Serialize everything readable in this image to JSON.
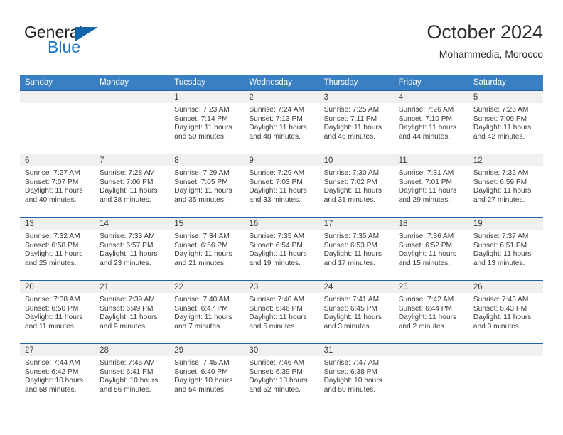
{
  "brand": {
    "name_part1": "General",
    "name_part2": "Blue",
    "accent_color": "#1264a8",
    "blue_text_color": "#1f76c2"
  },
  "header": {
    "title": "October 2024",
    "subtitle": "Mohammedia, Morocco"
  },
  "theme": {
    "header_row_bg": "#3a7fc1",
    "row_divider": "#1f63a8",
    "daynum_bg": "#f0f0f0",
    "text": "#3b3b3b"
  },
  "weekday_headers": [
    "Sunday",
    "Monday",
    "Tuesday",
    "Wednesday",
    "Thursday",
    "Friday",
    "Saturday"
  ],
  "weeks": [
    [
      {
        "day": "",
        "sunrise": "",
        "sunset": "",
        "daylight_line1": "",
        "daylight_line2": ""
      },
      {
        "day": "",
        "sunrise": "",
        "sunset": "",
        "daylight_line1": "",
        "daylight_line2": ""
      },
      {
        "day": "1",
        "sunrise": "Sunrise: 7:23 AM",
        "sunset": "Sunset: 7:14 PM",
        "daylight_line1": "Daylight: 11 hours",
        "daylight_line2": "and 50 minutes."
      },
      {
        "day": "2",
        "sunrise": "Sunrise: 7:24 AM",
        "sunset": "Sunset: 7:13 PM",
        "daylight_line1": "Daylight: 11 hours",
        "daylight_line2": "and 48 minutes."
      },
      {
        "day": "3",
        "sunrise": "Sunrise: 7:25 AM",
        "sunset": "Sunset: 7:11 PM",
        "daylight_line1": "Daylight: 11 hours",
        "daylight_line2": "and 46 minutes."
      },
      {
        "day": "4",
        "sunrise": "Sunrise: 7:26 AM",
        "sunset": "Sunset: 7:10 PM",
        "daylight_line1": "Daylight: 11 hours",
        "daylight_line2": "and 44 minutes."
      },
      {
        "day": "5",
        "sunrise": "Sunrise: 7:26 AM",
        "sunset": "Sunset: 7:09 PM",
        "daylight_line1": "Daylight: 11 hours",
        "daylight_line2": "and 42 minutes."
      }
    ],
    [
      {
        "day": "6",
        "sunrise": "Sunrise: 7:27 AM",
        "sunset": "Sunset: 7:07 PM",
        "daylight_line1": "Daylight: 11 hours",
        "daylight_line2": "and 40 minutes."
      },
      {
        "day": "7",
        "sunrise": "Sunrise: 7:28 AM",
        "sunset": "Sunset: 7:06 PM",
        "daylight_line1": "Daylight: 11 hours",
        "daylight_line2": "and 38 minutes."
      },
      {
        "day": "8",
        "sunrise": "Sunrise: 7:29 AM",
        "sunset": "Sunset: 7:05 PM",
        "daylight_line1": "Daylight: 11 hours",
        "daylight_line2": "and 35 minutes."
      },
      {
        "day": "9",
        "sunrise": "Sunrise: 7:29 AM",
        "sunset": "Sunset: 7:03 PM",
        "daylight_line1": "Daylight: 11 hours",
        "daylight_line2": "and 33 minutes."
      },
      {
        "day": "10",
        "sunrise": "Sunrise: 7:30 AM",
        "sunset": "Sunset: 7:02 PM",
        "daylight_line1": "Daylight: 11 hours",
        "daylight_line2": "and 31 minutes."
      },
      {
        "day": "11",
        "sunrise": "Sunrise: 7:31 AM",
        "sunset": "Sunset: 7:01 PM",
        "daylight_line1": "Daylight: 11 hours",
        "daylight_line2": "and 29 minutes."
      },
      {
        "day": "12",
        "sunrise": "Sunrise: 7:32 AM",
        "sunset": "Sunset: 6:59 PM",
        "daylight_line1": "Daylight: 11 hours",
        "daylight_line2": "and 27 minutes."
      }
    ],
    [
      {
        "day": "13",
        "sunrise": "Sunrise: 7:32 AM",
        "sunset": "Sunset: 6:58 PM",
        "daylight_line1": "Daylight: 11 hours",
        "daylight_line2": "and 25 minutes."
      },
      {
        "day": "14",
        "sunrise": "Sunrise: 7:33 AM",
        "sunset": "Sunset: 6:57 PM",
        "daylight_line1": "Daylight: 11 hours",
        "daylight_line2": "and 23 minutes."
      },
      {
        "day": "15",
        "sunrise": "Sunrise: 7:34 AM",
        "sunset": "Sunset: 6:56 PM",
        "daylight_line1": "Daylight: 11 hours",
        "daylight_line2": "and 21 minutes."
      },
      {
        "day": "16",
        "sunrise": "Sunrise: 7:35 AM",
        "sunset": "Sunset: 6:54 PM",
        "daylight_line1": "Daylight: 11 hours",
        "daylight_line2": "and 19 minutes."
      },
      {
        "day": "17",
        "sunrise": "Sunrise: 7:35 AM",
        "sunset": "Sunset: 6:53 PM",
        "daylight_line1": "Daylight: 11 hours",
        "daylight_line2": "and 17 minutes."
      },
      {
        "day": "18",
        "sunrise": "Sunrise: 7:36 AM",
        "sunset": "Sunset: 6:52 PM",
        "daylight_line1": "Daylight: 11 hours",
        "daylight_line2": "and 15 minutes."
      },
      {
        "day": "19",
        "sunrise": "Sunrise: 7:37 AM",
        "sunset": "Sunset: 6:51 PM",
        "daylight_line1": "Daylight: 11 hours",
        "daylight_line2": "and 13 minutes."
      }
    ],
    [
      {
        "day": "20",
        "sunrise": "Sunrise: 7:38 AM",
        "sunset": "Sunset: 6:50 PM",
        "daylight_line1": "Daylight: 11 hours",
        "daylight_line2": "and 11 minutes."
      },
      {
        "day": "21",
        "sunrise": "Sunrise: 7:39 AM",
        "sunset": "Sunset: 6:49 PM",
        "daylight_line1": "Daylight: 11 hours",
        "daylight_line2": "and 9 minutes."
      },
      {
        "day": "22",
        "sunrise": "Sunrise: 7:40 AM",
        "sunset": "Sunset: 6:47 PM",
        "daylight_line1": "Daylight: 11 hours",
        "daylight_line2": "and 7 minutes."
      },
      {
        "day": "23",
        "sunrise": "Sunrise: 7:40 AM",
        "sunset": "Sunset: 6:46 PM",
        "daylight_line1": "Daylight: 11 hours",
        "daylight_line2": "and 5 minutes."
      },
      {
        "day": "24",
        "sunrise": "Sunrise: 7:41 AM",
        "sunset": "Sunset: 6:45 PM",
        "daylight_line1": "Daylight: 11 hours",
        "daylight_line2": "and 3 minutes."
      },
      {
        "day": "25",
        "sunrise": "Sunrise: 7:42 AM",
        "sunset": "Sunset: 6:44 PM",
        "daylight_line1": "Daylight: 11 hours",
        "daylight_line2": "and 2 minutes."
      },
      {
        "day": "26",
        "sunrise": "Sunrise: 7:43 AM",
        "sunset": "Sunset: 6:43 PM",
        "daylight_line1": "Daylight: 11 hours",
        "daylight_line2": "and 0 minutes."
      }
    ],
    [
      {
        "day": "27",
        "sunrise": "Sunrise: 7:44 AM",
        "sunset": "Sunset: 6:42 PM",
        "daylight_line1": "Daylight: 10 hours",
        "daylight_line2": "and 58 minutes."
      },
      {
        "day": "28",
        "sunrise": "Sunrise: 7:45 AM",
        "sunset": "Sunset: 6:41 PM",
        "daylight_line1": "Daylight: 10 hours",
        "daylight_line2": "and 56 minutes."
      },
      {
        "day": "29",
        "sunrise": "Sunrise: 7:45 AM",
        "sunset": "Sunset: 6:40 PM",
        "daylight_line1": "Daylight: 10 hours",
        "daylight_line2": "and 54 minutes."
      },
      {
        "day": "30",
        "sunrise": "Sunrise: 7:46 AM",
        "sunset": "Sunset: 6:39 PM",
        "daylight_line1": "Daylight: 10 hours",
        "daylight_line2": "and 52 minutes."
      },
      {
        "day": "31",
        "sunrise": "Sunrise: 7:47 AM",
        "sunset": "Sunset: 6:38 PM",
        "daylight_line1": "Daylight: 10 hours",
        "daylight_line2": "and 50 minutes."
      },
      {
        "day": "",
        "sunrise": "",
        "sunset": "",
        "daylight_line1": "",
        "daylight_line2": ""
      },
      {
        "day": "",
        "sunrise": "",
        "sunset": "",
        "daylight_line1": "",
        "daylight_line2": ""
      }
    ]
  ]
}
